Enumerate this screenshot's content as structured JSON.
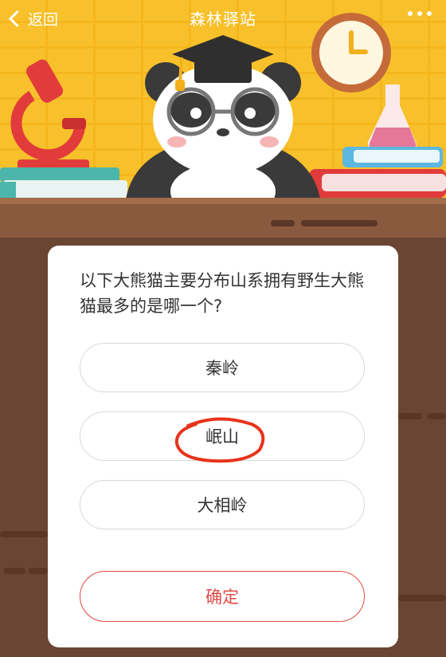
{
  "navbar": {
    "back_label": "返回",
    "title": "森林驿站"
  },
  "quiz": {
    "question": "以下大熊猫主要分布山系拥有野生大熊猫最多的是哪一个?",
    "options": [
      "秦岭",
      "岷山",
      "大相岭"
    ],
    "selected_option": "岷山",
    "confirm_label": "确定"
  },
  "colors": {
    "header_bg": "#f8c12b",
    "accent_red": "#e04a46",
    "desk_brown": "#6b4533",
    "annotation_circle": "#e8331c"
  },
  "icons": {
    "back": "chevron-left-icon",
    "more": "more-dots-icon"
  }
}
